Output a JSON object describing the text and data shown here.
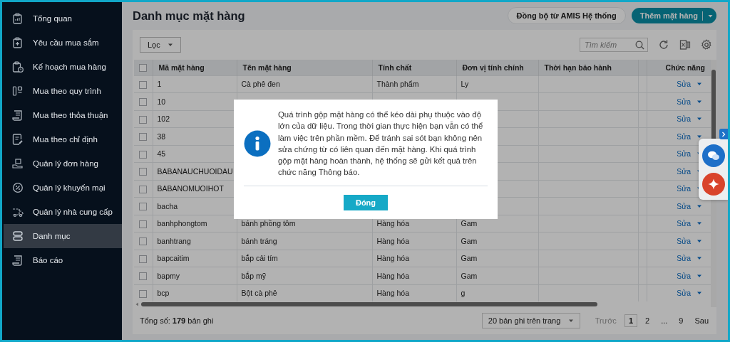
{
  "sidebar": {
    "items": [
      {
        "label": "Tổng quan",
        "selected": false
      },
      {
        "label": "Yêu cầu mua sắm",
        "selected": false
      },
      {
        "label": "Kế hoạch mua hàng",
        "selected": false
      },
      {
        "label": "Mua theo quy trình",
        "selected": false
      },
      {
        "label": "Mua theo thỏa thuận",
        "selected": false
      },
      {
        "label": "Mua theo chỉ định",
        "selected": false
      },
      {
        "label": "Quản lý đơn hàng",
        "selected": false
      },
      {
        "label": "Quản lý khuyến mại",
        "selected": false
      },
      {
        "label": "Quản lý nhà cung cấp",
        "selected": false
      },
      {
        "label": "Danh mục",
        "selected": true
      },
      {
        "label": "Báo cáo",
        "selected": false
      }
    ]
  },
  "header": {
    "title": "Danh mục mặt hàng",
    "sync_button": "Đồng bộ từ AMIS Hệ thống",
    "add_button": "Thêm mặt hàng"
  },
  "toolbar": {
    "filter": "Lọc",
    "search": {
      "placeholder": "Tìm kiếm"
    }
  },
  "table": {
    "columns": [
      "Mã mặt hàng",
      "Tên mặt hàng",
      "Tính chất",
      "Đơn vị tính chính",
      "Thời hạn bảo hành",
      "Chức năng"
    ],
    "header_checked": false,
    "rows": [
      {
        "checked": false,
        "cells": [
          "1",
          "Cà phê đen",
          "Thành phẩm",
          "Ly",
          ""
        ],
        "action": "Sửa"
      },
      {
        "checked": false,
        "cells": [
          "10"
        ],
        "action": "Sửa"
      },
      {
        "checked": false,
        "cells": [
          "102"
        ],
        "action": "Sửa"
      },
      {
        "checked": false,
        "cells": [
          "38"
        ],
        "action": "Sửa"
      },
      {
        "checked": false,
        "cells": [
          "45"
        ],
        "action": "Sửa"
      },
      {
        "checked": false,
        "cells": [
          "BABANAUCHUOIDAU"
        ],
        "action": "Sửa"
      },
      {
        "checked": false,
        "cells": [
          "BABANOMUOIHOT"
        ],
        "action": "Sửa"
      },
      {
        "checked": false,
        "cells": [
          "bacha"
        ],
        "action": "Sửa"
      },
      {
        "checked": false,
        "cells": [
          "banhphongtom",
          "bánh phồng tôm",
          "Hàng hóa",
          "Gam"
        ],
        "action": "Sửa"
      },
      {
        "checked": false,
        "cells": [
          "banhtrang",
          "bánh tráng",
          "Hàng hóa",
          "Gam"
        ],
        "action": "Sửa"
      },
      {
        "checked": false,
        "cells": [
          "bapcaitim",
          "bắp cải tím",
          "Hàng hóa",
          "Gam"
        ],
        "action": "Sửa"
      },
      {
        "checked": false,
        "cells": [
          "bapmy",
          "bắp mỹ",
          "Hàng hóa",
          "Gam"
        ],
        "action": "Sửa"
      },
      {
        "checked": false,
        "cells": [
          "bcp",
          "Bột cà phê",
          "Hàng hóa",
          "g"
        ],
        "action": "Sửa"
      }
    ]
  },
  "footer": {
    "total": "Tổng số: **179** bản ghi",
    "page_size": "20 bản ghi trên trang",
    "prev": {
      "label": "Trước",
      "disabled": true
    },
    "pages": [
      {
        "label": "1",
        "selected": true
      },
      {
        "label": "2",
        "selected": false
      },
      {
        "label": "...",
        "selected": false
      },
      {
        "label": "9",
        "selected": false
      }
    ],
    "next": {
      "label": "Sau",
      "disabled": false
    }
  },
  "dialog": {
    "message": "Quá trình gộp mặt hàng có thể kéo dài phụ thuộc vào độ lớn của dữ liệu. Trong thời gian thực hiện bạn vẫn có thể làm việc trên phần mềm. Để tránh sai sót bạn không nên sửa chứng từ có liên quan đến mặt hàng. Khi quá trình gộp mặt hàng hoàn thành, hệ thống sẽ gửi kết quả trên chức năng Thông báo.",
    "close_button": "Đóng"
  }
}
